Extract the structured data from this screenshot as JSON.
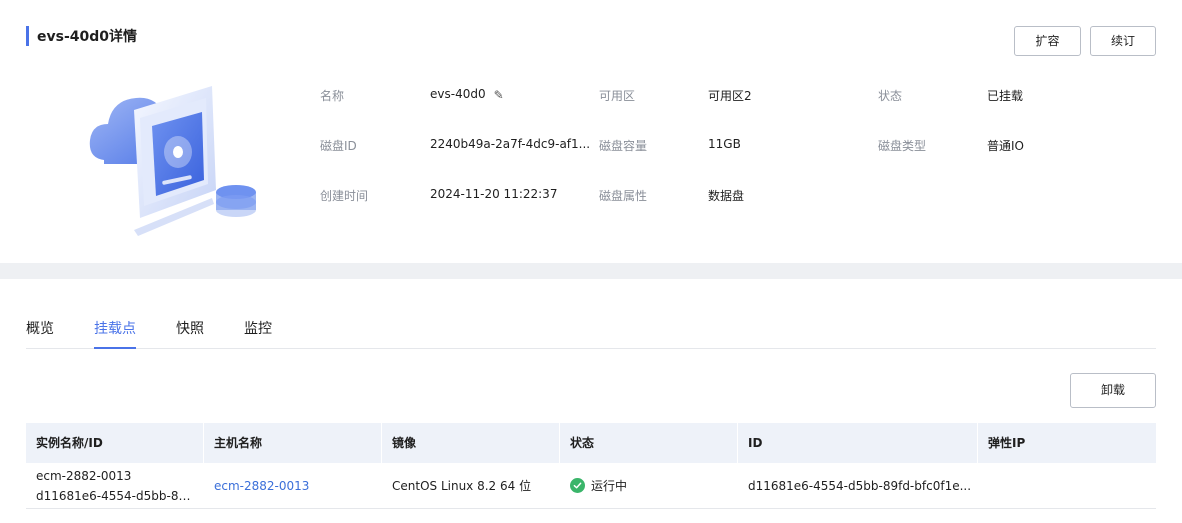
{
  "header": {
    "title": "evs-40d0详情",
    "expand_label": "扩容",
    "renew_label": "续订"
  },
  "info": {
    "name_label": "名称",
    "name_value": "evs-40d0",
    "az_label": "可用区",
    "az_value": "可用区2",
    "status_label": "状态",
    "status_value": "已挂载",
    "disk_id_label": "磁盘ID",
    "disk_id_value": "2240b49a-2a7f-4dc9-af1...",
    "capacity_label": "磁盘容量",
    "capacity_value": "11GB",
    "type_label": "磁盘类型",
    "type_value": "普通IO",
    "created_label": "创建时间",
    "created_value": "2024-11-20 11:22:37",
    "attr_label": "磁盘属性",
    "attr_value": "数据盘"
  },
  "tabs": [
    {
      "label": "概览",
      "active": false
    },
    {
      "label": "挂载点",
      "active": true
    },
    {
      "label": "快照",
      "active": false
    },
    {
      "label": "监控",
      "active": false
    }
  ],
  "actions": {
    "detach_label": "卸载"
  },
  "table": {
    "columns": [
      "实例名称/ID",
      "主机名称",
      "镜像",
      "状态",
      "ID",
      "弹性IP"
    ],
    "rows": [
      {
        "instance_name": "ecm-2882-0013",
        "instance_id": "d11681e6-4554-d5bb-89...",
        "host_name": "ecm-2882-0013",
        "image": "CentOS Linux 8.2 64 位",
        "status": "运行中",
        "id": "d11681e6-4554-d5bb-89fd-bfc0f1e...",
        "eip": ""
      }
    ]
  },
  "colors": {
    "accent": "#4a73e8",
    "link": "#3b6fd9",
    "status_running": "#3ab56a"
  }
}
